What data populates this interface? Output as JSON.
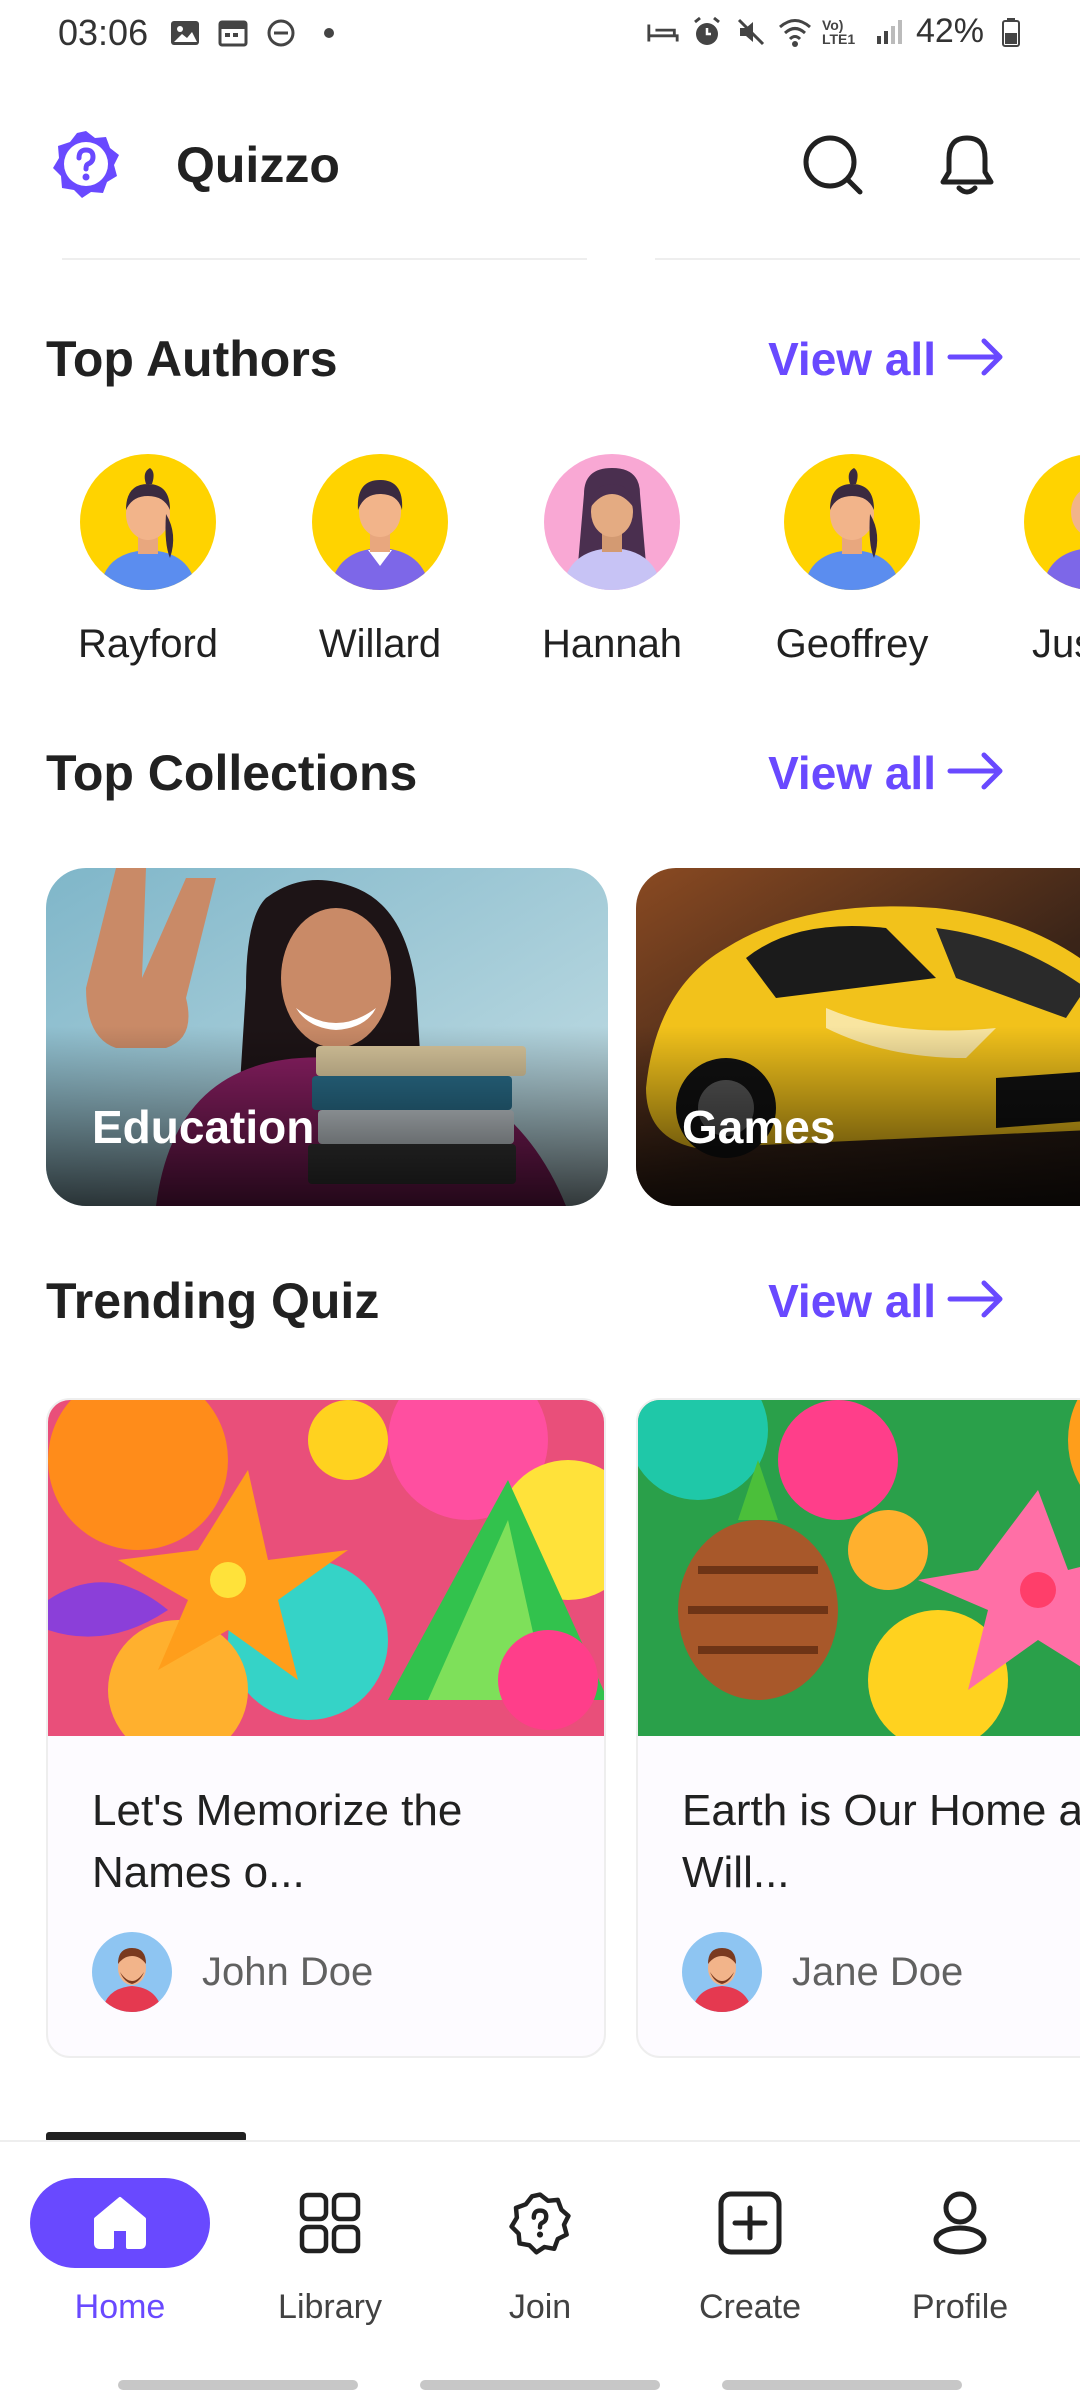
{
  "status_bar": {
    "time": "03:06",
    "battery": "42%",
    "left_icons": [
      "gallery-icon",
      "calendar-icon",
      "dnd-icon",
      "dot-icon"
    ],
    "right_icons": [
      "sleep-icon",
      "alarm-icon",
      "mute-icon",
      "wifi-icon",
      "volte-icon",
      "signal-icon",
      "battery-icon"
    ],
    "volte_label": "Vo) LTE1"
  },
  "header": {
    "title": "Quizzo",
    "accent_color": "#6949ff"
  },
  "sections": {
    "authors": {
      "title": "Top Authors",
      "view_all": "View all"
    },
    "collections": {
      "title": "Top Collections",
      "view_all": "View all"
    },
    "trending": {
      "title": "Trending Quiz",
      "view_all": "View all"
    }
  },
  "authors": [
    {
      "name": "Rayford",
      "avatar_bg": "#ffd300"
    },
    {
      "name": "Willard",
      "avatar_bg": "#ffd300"
    },
    {
      "name": "Hannah",
      "avatar_bg": "#f9a8d4"
    },
    {
      "name": "Geoffrey",
      "avatar_bg": "#ffd300"
    },
    {
      "name": "Jus",
      "avatar_bg": "#ffd300"
    }
  ],
  "collections": [
    {
      "label": "Education"
    },
    {
      "label": "Games"
    }
  ],
  "quizzes": [
    {
      "title": "Let's Memorize the Names o...",
      "author": "John Doe"
    },
    {
      "title": "Earth is Our Home and Will...",
      "author": "Jane Doe"
    }
  ],
  "nav": [
    {
      "label": "Home",
      "icon": "home-icon",
      "active": true
    },
    {
      "label": "Library",
      "icon": "library-icon",
      "active": false
    },
    {
      "label": "Join",
      "icon": "join-icon",
      "active": false
    },
    {
      "label": "Create",
      "icon": "create-icon",
      "active": false
    },
    {
      "label": "Profile",
      "icon": "profile-icon",
      "active": false
    }
  ]
}
